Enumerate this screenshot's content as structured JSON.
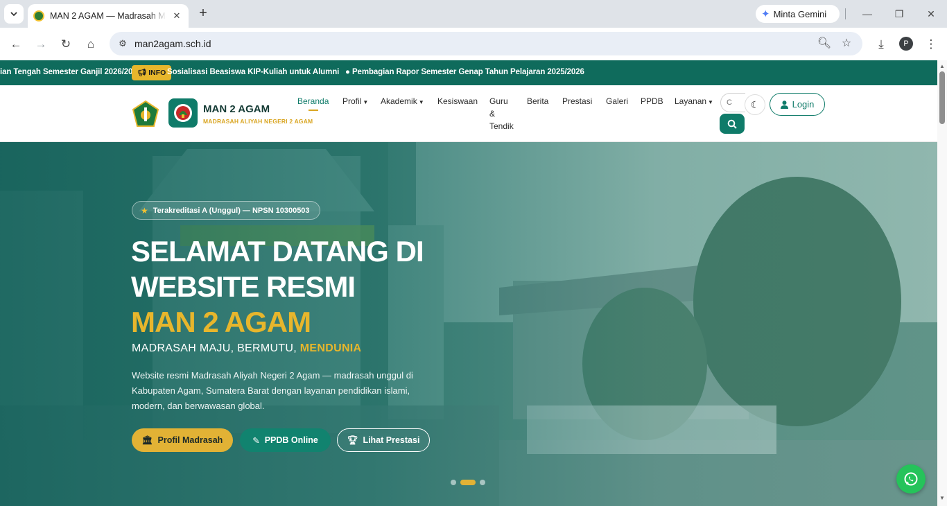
{
  "browser": {
    "tab_title": "MAN 2 AGAM — Madrasah Ma",
    "url": "man2agam.sch.id",
    "gemini_label": "Minta Gemini",
    "profile_initial": "P"
  },
  "ticker": {
    "item_1": "ian Tengah Semester Ganjil 2026/2027",
    "badge": "INFO",
    "item_2": "Sosialisasi Beasiswa KIP-Kuliah untuk Alumni",
    "item_3": "Pembagian Rapor Semester Genap Tahun Pelajaran 2025/2026"
  },
  "header": {
    "brand_name": "MAN 2 AGAM",
    "brand_sub": "MADRASAH ALIYAH NEGERI 2 AGAM",
    "menu": {
      "beranda": "Beranda",
      "profil": "Profil",
      "akademik": "Akademik",
      "kesiswaan": "Kesiswaan",
      "guru_1": "Guru",
      "guru_2": "&",
      "guru_3": "Tendik",
      "berita": "Berita",
      "prestasi": "Prestasi",
      "galeri": "Galeri",
      "ppdb": "PPDB",
      "layanan": "Layanan"
    },
    "search_placeholder": "C",
    "login_label": "Login"
  },
  "hero": {
    "badge": "Terakreditasi A (Unggul) — NPSN 10300503",
    "title_line_1": "SELAMAT DATANG DI",
    "title_line_2": "WEBSITE RESMI",
    "title_line_3": "MAN 2 AGAM",
    "tagline_prefix": "MADRASAH MAJU, BERMUTU,",
    "tagline_highlight": "MENDUNIA",
    "description": "Website resmi Madrasah Aliyah Negeri 2 Agam — madrasah unggul di Kabupaten Agam, Sumatera Barat dengan layanan pendidikan islami, modern, dan berwawasan global.",
    "btn_profil": "Profil Madrasah",
    "btn_ppdb": "PPDB Online",
    "btn_prestasi": "Lihat Prestasi",
    "slide_count": 3,
    "active_slide": 2
  },
  "colors": {
    "primary": "#0f7b69",
    "ticker_bg": "#0f6b5c",
    "gold": "#e2b235",
    "whatsapp": "#25c35a"
  }
}
